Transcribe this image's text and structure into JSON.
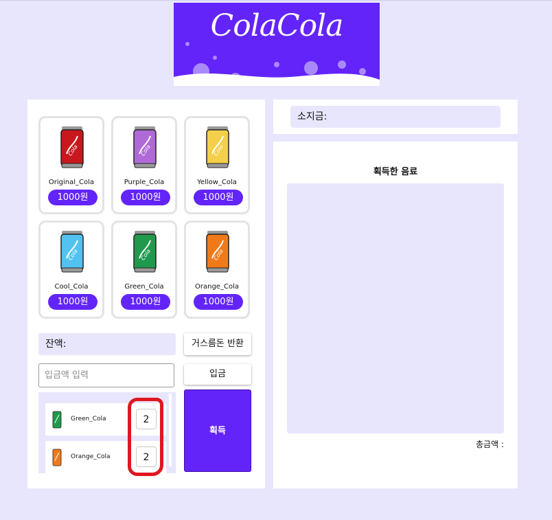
{
  "logo": {
    "text": "ColaCola"
  },
  "colas": [
    {
      "name": "Original_Cola",
      "price": "1000원",
      "color": "#c8171d",
      "dark": "#8e0e12"
    },
    {
      "name": "Purple_Cola",
      "price": "1000원",
      "color": "#b06ad8",
      "dark": "#7d3fa6"
    },
    {
      "name": "Yellow_Cola",
      "price": "1000원",
      "color": "#f4cf4a",
      "dark": "#c9a227"
    },
    {
      "name": "Cool_Cola",
      "price": "1000원",
      "color": "#52c3f1",
      "dark": "#2a92bf"
    },
    {
      "name": "Green_Cola",
      "price": "1000원",
      "color": "#1f9a4c",
      "dark": "#106b31"
    },
    {
      "name": "Orange_Cola",
      "price": "1000원",
      "color": "#f07a1a",
      "dark": "#b8540a"
    }
  ],
  "balance_label": "잔액:",
  "change_button": "거스름돈 반환",
  "deposit_placeholder": "입금액 입력",
  "deposit_button": "입금",
  "get_button": "획득",
  "cart": [
    {
      "name": "Green_Cola",
      "qty": "2",
      "color": "#1f9a4c"
    },
    {
      "name": "Orange_Cola",
      "qty": "2",
      "color": "#f07a1a"
    }
  ],
  "money_label": "소지금:",
  "acquired_title": "획득한 음료",
  "total_label": "총금액 :",
  "accent_color": "#6324fa",
  "annotation_color": "#e01620"
}
